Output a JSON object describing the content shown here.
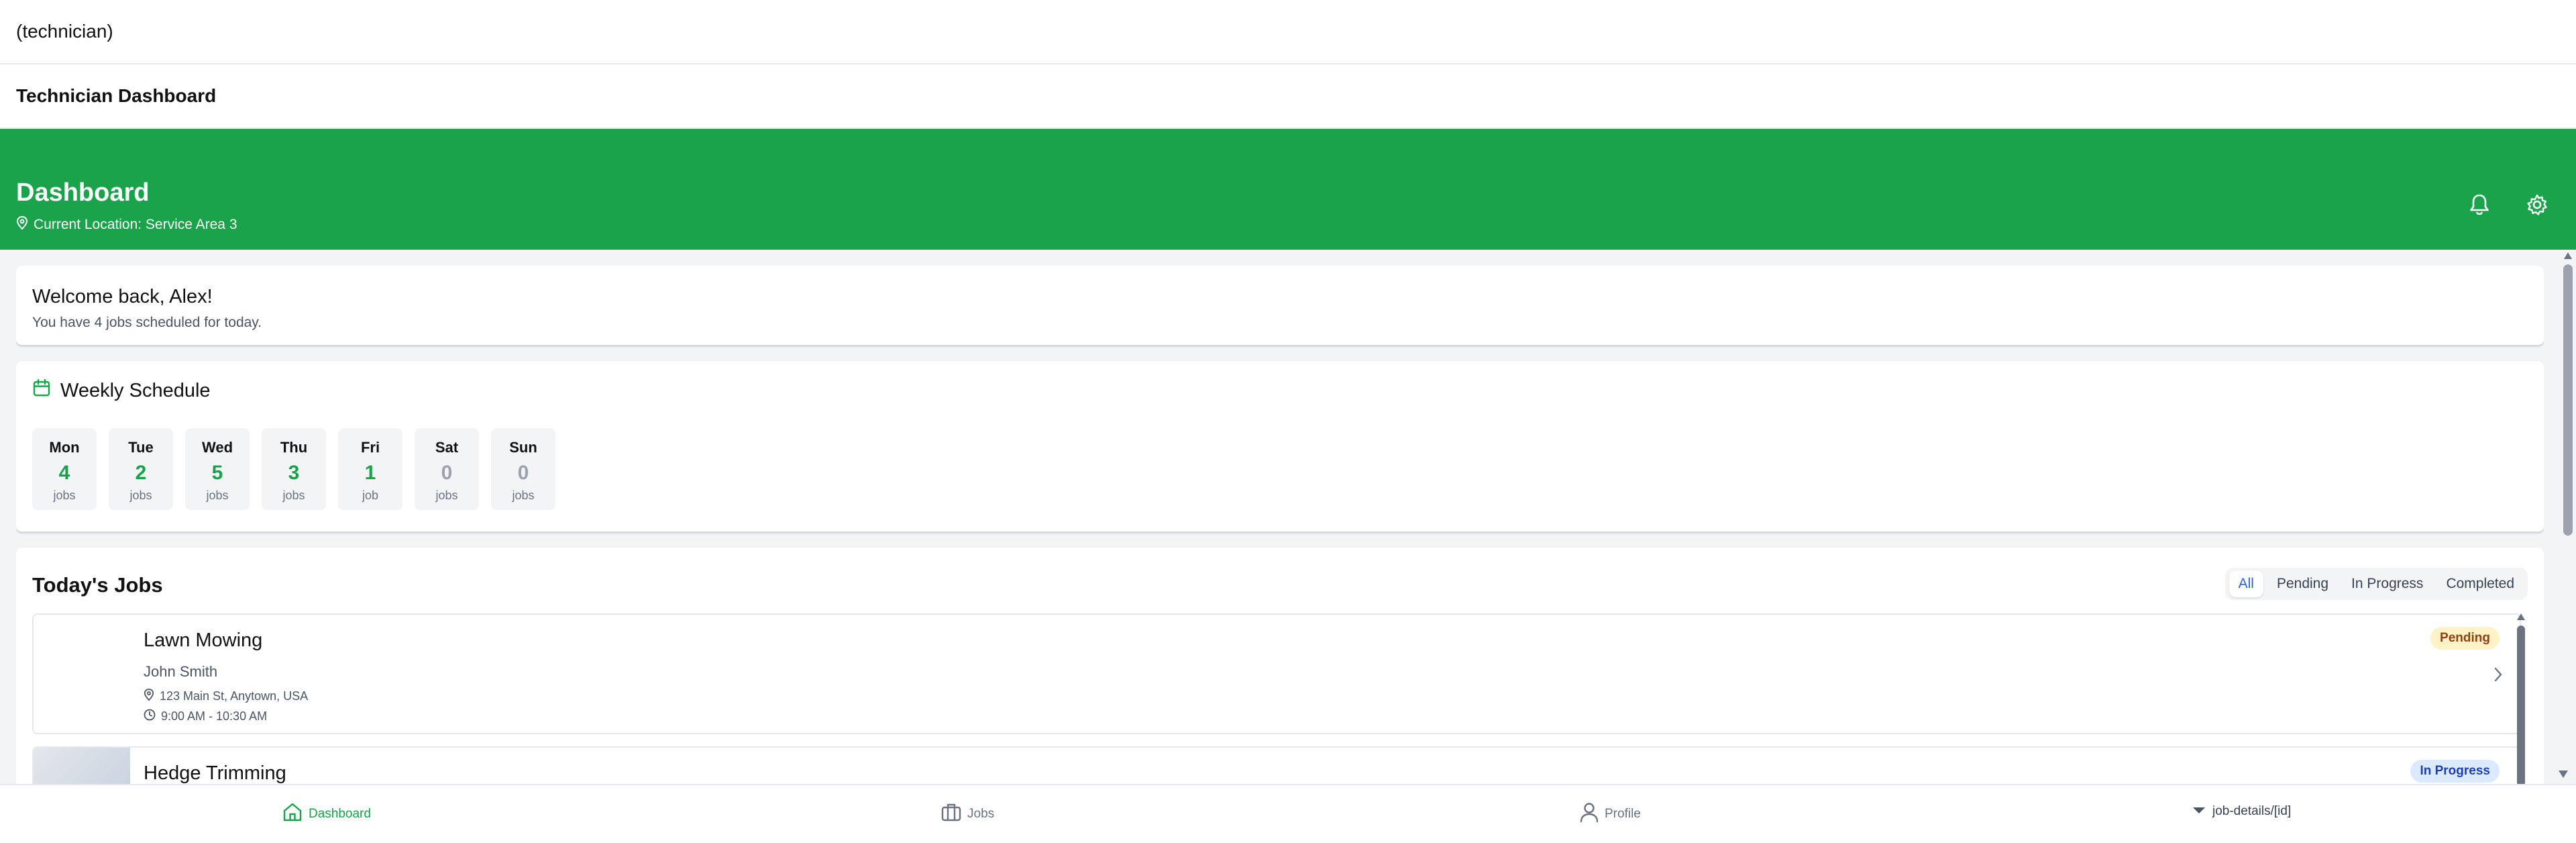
{
  "topbar": {
    "title": "(technician)"
  },
  "subbar": {
    "title": "Technician Dashboard"
  },
  "hero": {
    "title": "Dashboard",
    "location": "Current Location: Service Area 3",
    "icons": [
      "bell-icon",
      "gear-icon"
    ]
  },
  "welcome": {
    "heading": "Welcome back, Alex!",
    "text": "You have 4 jobs scheduled for today."
  },
  "weekly": {
    "title": "Weekly Schedule",
    "days": [
      {
        "name": "Mon",
        "count": "4",
        "unit": "jobs"
      },
      {
        "name": "Tue",
        "count": "2",
        "unit": "jobs"
      },
      {
        "name": "Wed",
        "count": "5",
        "unit": "jobs"
      },
      {
        "name": "Thu",
        "count": "3",
        "unit": "jobs"
      },
      {
        "name": "Fri",
        "count": "1",
        "unit": "job"
      },
      {
        "name": "Sat",
        "count": "0",
        "unit": "jobs"
      },
      {
        "name": "Sun",
        "count": "0",
        "unit": "jobs"
      }
    ]
  },
  "jobs": {
    "title": "Today's Jobs",
    "filters": [
      "All",
      "Pending",
      "In Progress",
      "Completed"
    ],
    "active_filter": "All",
    "items": [
      {
        "title": "Lawn Mowing",
        "customer": "John Smith",
        "address": "123 Main St, Anytown, USA",
        "time": "9:00 AM - 10:30 AM",
        "status": "Pending"
      },
      {
        "title": "Hedge Trimming",
        "status": "In Progress"
      }
    ]
  },
  "nav": {
    "items": [
      {
        "label": "Dashboard",
        "icon": "home-icon"
      },
      {
        "label": "Jobs",
        "icon": "briefcase-icon"
      },
      {
        "label": "Profile",
        "icon": "user-icon"
      },
      {
        "label": "job-details/[id]",
        "icon": "chevron-down-icon"
      }
    ],
    "active": "Dashboard"
  },
  "colors": {
    "brand": "#1aa34a",
    "accent_text": "#16a34a",
    "filter_active": "#2563eb"
  }
}
